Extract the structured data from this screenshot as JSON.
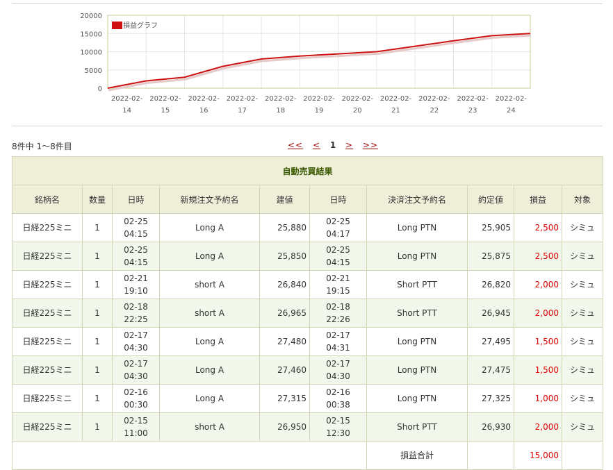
{
  "chart_data": {
    "type": "line",
    "legend": "損益グラフ",
    "x": [
      "2022-02-14",
      "2022-02-15",
      "2022-02-16",
      "2022-02-17",
      "2022-02-18",
      "2022-02-19",
      "2022-02-20",
      "2022-02-21",
      "2022-02-22",
      "2022-02-23",
      "2022-02-24"
    ],
    "tick_lines": [
      [
        "2022-02-",
        "14"
      ],
      [
        "2022-02-",
        "15"
      ],
      [
        "2022-02-",
        "16"
      ],
      [
        "2022-02-",
        "17"
      ],
      [
        "2022-02-",
        "18"
      ],
      [
        "2022-02-",
        "19"
      ],
      [
        "2022-02-",
        "20"
      ],
      [
        "2022-02-",
        "21"
      ],
      [
        "2022-02-",
        "22"
      ],
      [
        "2022-02-",
        "23"
      ],
      [
        "2022-02-",
        "24"
      ]
    ],
    "series": [
      {
        "name": "損益グラフ",
        "color": "#cc1111",
        "points": [
          [
            0,
            0
          ],
          [
            1,
            2000
          ],
          [
            2,
            3000
          ],
          [
            3,
            6000
          ],
          [
            4,
            8000
          ],
          [
            5,
            8800
          ],
          [
            6,
            9400
          ],
          [
            7,
            10000
          ],
          [
            8,
            11500
          ],
          [
            9,
            13000
          ],
          [
            10,
            14400
          ],
          [
            11,
            15000
          ]
        ]
      }
    ],
    "ylim": [
      0,
      20000
    ],
    "yticks": [
      "0",
      "5000",
      "10000",
      "15000",
      "20000"
    ],
    "grid": true,
    "legend_position": "top-left"
  },
  "pager": {
    "count_text": "8件中 1〜8件目",
    "first": "<<",
    "prev": "<",
    "current": "1",
    "next": ">",
    "last": ">>"
  },
  "table": {
    "title": "自動売買結果",
    "headers": [
      "銘柄名",
      "数量",
      "日時",
      "新規注文予約名",
      "建値",
      "日時",
      "決済注文予約名",
      "約定値",
      "損益",
      "対象"
    ],
    "rows": [
      [
        "日経225ミニ",
        "1",
        "02-25\n04:15",
        "Long A",
        "25,880",
        "02-25\n04:17",
        "Long PTN",
        "25,905",
        "2,500",
        "シミュ"
      ],
      [
        "日経225ミニ",
        "1",
        "02-25\n04:15",
        "Long A",
        "25,850",
        "02-25\n04:15",
        "Long PTN",
        "25,875",
        "2,500",
        "シミュ"
      ],
      [
        "日経225ミニ",
        "1",
        "02-21\n19:10",
        "short A",
        "26,840",
        "02-21\n19:15",
        "Short PTT",
        "26,820",
        "2,000",
        "シミュ"
      ],
      [
        "日経225ミニ",
        "1",
        "02-18\n22:25",
        "short A",
        "26,965",
        "02-18\n22:26",
        "Short PTT",
        "26,945",
        "2,000",
        "シミュ"
      ],
      [
        "日経225ミニ",
        "1",
        "02-17\n04:30",
        "Long A",
        "27,480",
        "02-17\n04:31",
        "Long PTN",
        "27,495",
        "1,500",
        "シミュ"
      ],
      [
        "日経225ミニ",
        "1",
        "02-17\n04:30",
        "Long A",
        "27,460",
        "02-17\n04:30",
        "Long PTN",
        "27,475",
        "1,500",
        "シミュ"
      ],
      [
        "日経225ミニ",
        "1",
        "02-16\n00:30",
        "Long A",
        "27,315",
        "02-16\n00:38",
        "Long PTN",
        "27,325",
        "1,000",
        "シミュ"
      ],
      [
        "日経225ミニ",
        "1",
        "02-15\n11:00",
        "short A",
        "26,950",
        "02-15\n12:30",
        "Short PTT",
        "26,930",
        "2,000",
        "シミュ"
      ]
    ],
    "total_label": "損益合計",
    "total_value": "15,000"
  }
}
